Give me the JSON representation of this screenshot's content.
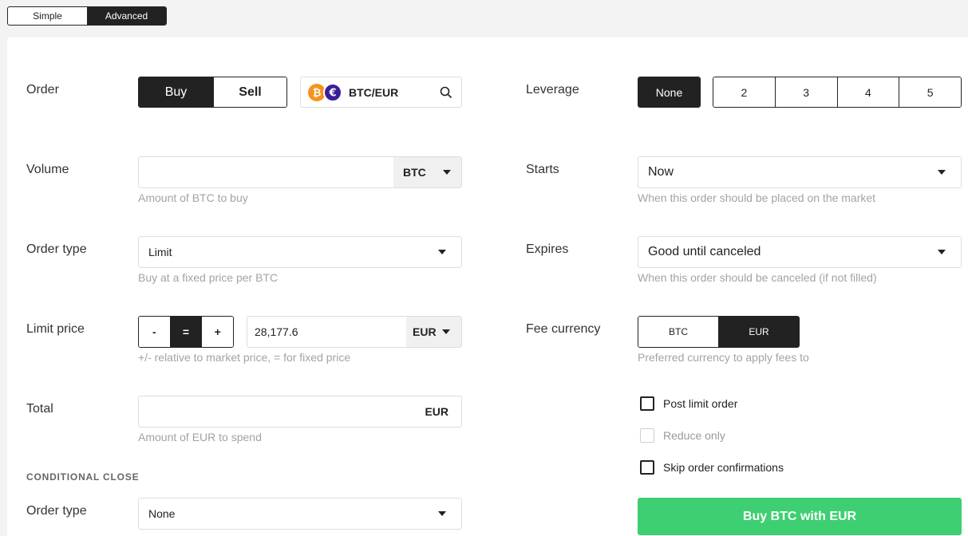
{
  "mode_toggle": {
    "simple": "Simple",
    "advanced": "Advanced"
  },
  "order": {
    "label": "Order",
    "buy": "Buy",
    "sell": "Sell",
    "pair": "BTC/EUR"
  },
  "leverage": {
    "label": "Leverage",
    "options": [
      "None",
      "2",
      "3",
      "4",
      "5"
    ],
    "selected": "None"
  },
  "volume": {
    "label": "Volume",
    "value": "",
    "unit": "BTC",
    "hint": "Amount of BTC to buy"
  },
  "starts": {
    "label": "Starts",
    "value": "Now",
    "hint": "When this order should be placed on the market"
  },
  "order_type": {
    "label": "Order type",
    "value": "Limit",
    "hint": "Buy at a fixed price per BTC"
  },
  "expires": {
    "label": "Expires",
    "value": "Good until canceled",
    "hint": "When this order should be canceled (if not filled)"
  },
  "limit_price": {
    "label": "Limit price",
    "minus": "-",
    "equals": "=",
    "plus": "+",
    "value": "28,177.6",
    "unit": "EUR",
    "hint": "+/- relative to market price, = for fixed price"
  },
  "fee_currency": {
    "label": "Fee currency",
    "options": [
      "BTC",
      "EUR"
    ],
    "selected": "EUR",
    "hint": "Preferred currency to apply fees to"
  },
  "total": {
    "label": "Total",
    "value": "",
    "unit": "EUR",
    "hint": "Amount of EUR to spend"
  },
  "checkboxes": {
    "post_limit": "Post limit order",
    "reduce_only": "Reduce only",
    "skip_confirm": "Skip order confirmations"
  },
  "conditional_close": {
    "title": "CONDITIONAL CLOSE",
    "label": "Order type",
    "value": "None"
  },
  "submit_label": "Buy BTC with EUR",
  "colors": {
    "accent": "#222222",
    "submit": "#3ecf72",
    "btc": "#f7931a",
    "eur": "#3b1e9a"
  },
  "icons": {
    "btc": "bitcoin-icon",
    "eur": "euro-icon",
    "search": "search-icon"
  }
}
